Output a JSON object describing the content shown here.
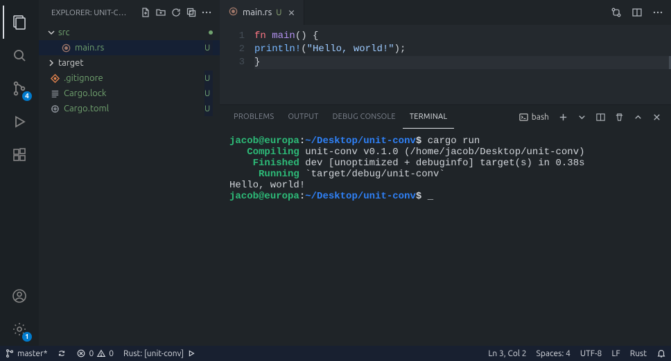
{
  "sidebar": {
    "title": "EXPLORER: UNIT-C…",
    "tree": {
      "src": {
        "name": "src"
      },
      "main_rs": {
        "name": "main.rs",
        "status": "U"
      },
      "target": {
        "name": "target"
      },
      "gitignore": {
        "name": ".gitignore",
        "status": "U"
      },
      "cargo_lock": {
        "name": "Cargo.lock",
        "status": "U"
      },
      "cargo_toml": {
        "name": "Cargo.toml",
        "status": "U"
      }
    }
  },
  "activity": {
    "scm_badge": "4",
    "settings_badge": "1"
  },
  "tab": {
    "label": "main.rs",
    "modified": "U"
  },
  "editor": {
    "lines": {
      "l1": "1",
      "l2": "2",
      "l3": "3"
    },
    "code": {
      "fn_kw": "fn",
      "fn_name": "main",
      "fn_parens": "()",
      "brace_open": " {",
      "indent": "    ",
      "println": "println!",
      "open_paren": "(",
      "string": "\"Hello, world!\"",
      "close_call": ");",
      "brace_close": "}"
    }
  },
  "panel": {
    "tabs": {
      "problems": "PROBLEMS",
      "output": "OUTPUT",
      "debug": "DEBUG CONSOLE",
      "terminal": "TERMINAL"
    },
    "shell": "bash"
  },
  "terminal": {
    "user": "jacob",
    "at": "@",
    "host": "europa",
    "colon": ":",
    "path": "~/Desktop/unit-conv",
    "prompt": "$",
    "cmd": " cargo run",
    "compiling_lbl": "Compiling",
    "compiling_txt": " unit-conv v0.1.0 (/home/jacob/Desktop/unit-conv)",
    "finished_lbl": "Finished",
    "finished_txt": " dev [unoptimized + debuginfo] target(s) in 0.38s",
    "running_lbl": "Running",
    "running_txt": " `target/debug/unit-conv`",
    "output": "Hello, world!",
    "cursor": " _"
  },
  "status": {
    "branch": "master*",
    "errors": "0",
    "warnings": "0",
    "rust": "Rust: [unit-conv]",
    "lncol": "Ln 3, Col 2",
    "spaces": "Spaces: 4",
    "encoding": "UTF-8",
    "eol": "LF",
    "lang": "Rust"
  }
}
